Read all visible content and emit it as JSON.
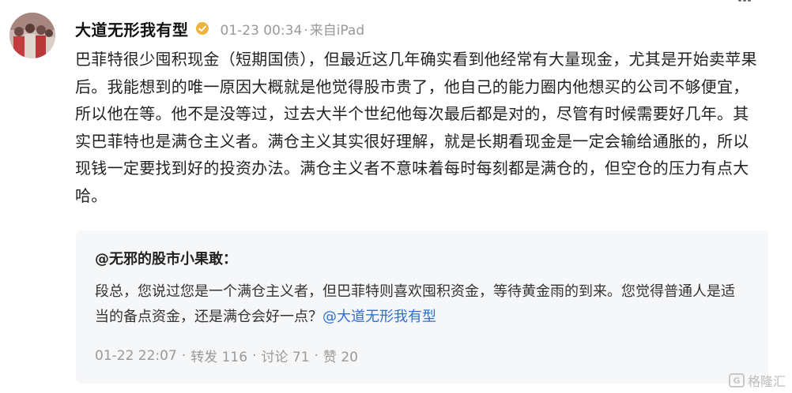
{
  "post": {
    "author": "大道无形我有型",
    "timestamp": "01-23 00:34",
    "separator": "·",
    "source": "来自iPad",
    "body": "巴菲特很少囤积现金（短期国债），但最近这几年确实看到他经常有大量现金，尤其是开始卖苹果后。我能想到的唯一原因大概就是他觉得股市贵了，他自己的能力圈内他想买的公司不够便宜，所以他在等。他不是没等过，过去大半个世纪他每次最后都是对的，尽管有时候需要好几年。其实巴菲特也是满仓主义者。满仓主义其实很好理解，就是长期看现金是一定会输给通胀的，所以现钱一定要找到好的投资办法。满仓主义者不意味着每时每刻都是满仓的，但空仓的压力有点大哈。"
  },
  "quote": {
    "author": "@无邪的股市小果敢：",
    "text": "段总，您说过您是一个满仓主义者，但巴菲特则喜欢囤积资金，等待黄金雨的到来。您觉得普通人是适当的备点资金，还是满仓会好一点？",
    "mention": "@大道无形我有型",
    "time": "01-22 22:07",
    "dot": "·",
    "repost": "转发 116",
    "comment": "讨论 71",
    "like": "赞 20"
  },
  "watermark": {
    "logo_letter": "G",
    "text": "格隆汇"
  },
  "icons": {
    "badge": "gold-verified-icon",
    "more": "more-dots-icon"
  },
  "colors": {
    "mention": "#2e6fd1",
    "badge": "#f0b23a",
    "quote_bg": "#f6f7f9",
    "meta": "#999999"
  }
}
